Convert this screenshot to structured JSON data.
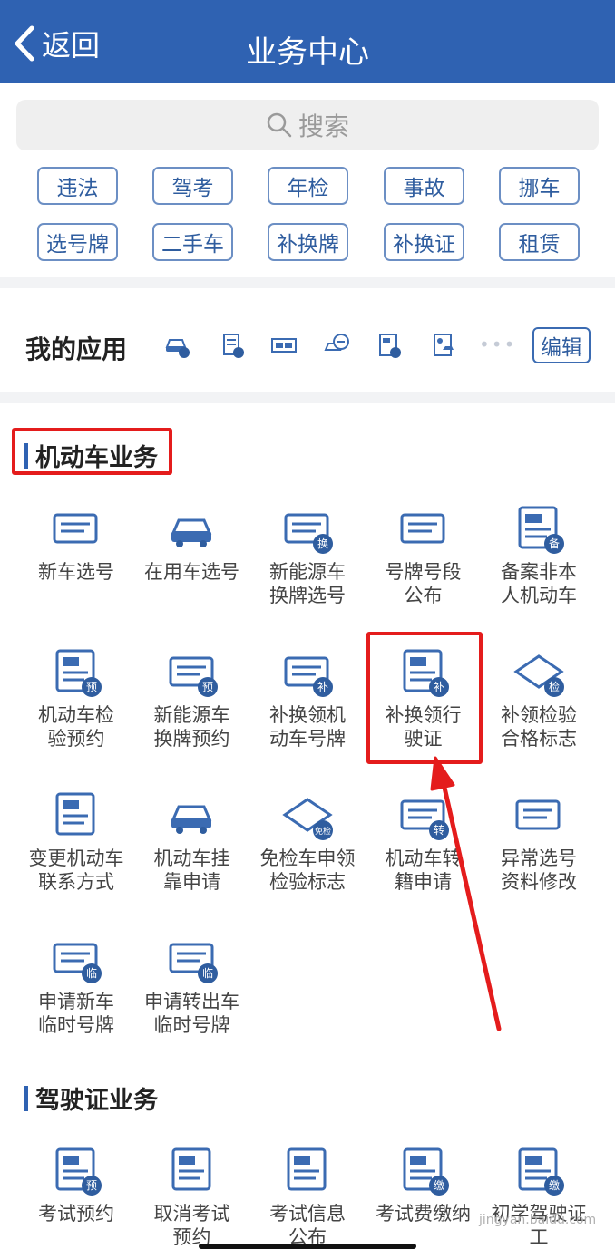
{
  "nav": {
    "back_label": "返回",
    "title": "业务中心"
  },
  "search": {
    "placeholder": "搜索"
  },
  "quick_tags": [
    "违法",
    "驾考",
    "年检",
    "事故",
    "挪车",
    "选号牌",
    "二手车",
    "补换牌",
    "补换证",
    "租赁"
  ],
  "my_apps": {
    "label": "我的应用",
    "icons": [
      "car-violation-icon",
      "document-license-icon",
      "plate-exchange-icon",
      "car-service-icon",
      "license-renew-icon",
      "registration-card-icon"
    ],
    "more": "•••",
    "edit_label": "编辑"
  },
  "sections": [
    {
      "title": "机动车业务",
      "highlighted": true,
      "items": [
        {
          "label": "新车选号",
          "icon": "new-plate-icon"
        },
        {
          "label": "在用车选号",
          "icon": "used-car-plate-icon"
        },
        {
          "label": "新能源车\n换牌选号",
          "icon": "ev-plate-icon",
          "badge": "换"
        },
        {
          "label": "号牌号段\n公布",
          "icon": "plate-range-board-icon"
        },
        {
          "label": "备案非本\n人机动车",
          "icon": "record-vehicle-icon",
          "badge": "备"
        },
        {
          "label": "机动车检\n验预约",
          "icon": "inspection-booking-icon",
          "badge": "预"
        },
        {
          "label": "新能源车\n换牌预约",
          "icon": "ev-plate-booking-icon",
          "badge": "预"
        },
        {
          "label": "补换领机\n动车号牌",
          "icon": "replace-plate-icon",
          "badge": "补"
        },
        {
          "label": "补换领行\n驶证",
          "icon": "replace-license-icon",
          "badge": "补",
          "highlighted": true
        },
        {
          "label": "补领检验\n合格标志",
          "icon": "inspection-mark-icon",
          "badge": "检"
        },
        {
          "label": "变更机动车\n联系方式",
          "icon": "change-contact-icon"
        },
        {
          "label": "机动车挂\n靠申请",
          "icon": "affiliation-icon"
        },
        {
          "label": "免检车申领\n检验标志",
          "icon": "exempt-mark-icon",
          "badge": "免检"
        },
        {
          "label": "机动车转\n籍申请",
          "icon": "transfer-icon",
          "badge": "转"
        },
        {
          "label": "异常选号\n资料修改",
          "icon": "abnormal-plate-icon"
        },
        {
          "label": "申请新车\n临时号牌",
          "icon": "temp-plate-new-icon",
          "badge": "临"
        },
        {
          "label": "申请转出车\n临时号牌",
          "icon": "temp-plate-out-icon",
          "badge": "临"
        }
      ]
    },
    {
      "title": "驾驶证业务",
      "items": [
        {
          "label": "考试预约",
          "icon": "exam-booking-icon",
          "badge": "预"
        },
        {
          "label": "取消考试\n预约",
          "icon": "cancel-exam-icon"
        },
        {
          "label": "考试信息\n公布",
          "icon": "exam-info-icon"
        },
        {
          "label": "考试费缴纳",
          "icon": "exam-fee-icon",
          "badge": "缴"
        },
        {
          "label": "初学驾驶证工\n本费缴纳",
          "icon": "license-fee-icon",
          "badge": "缴"
        }
      ]
    }
  ],
  "watermark": "jingyan.baidu.com",
  "colors": {
    "primary": "#2f62b2",
    "highlight": "#e41c1c",
    "divider": "#f2f3f5"
  }
}
